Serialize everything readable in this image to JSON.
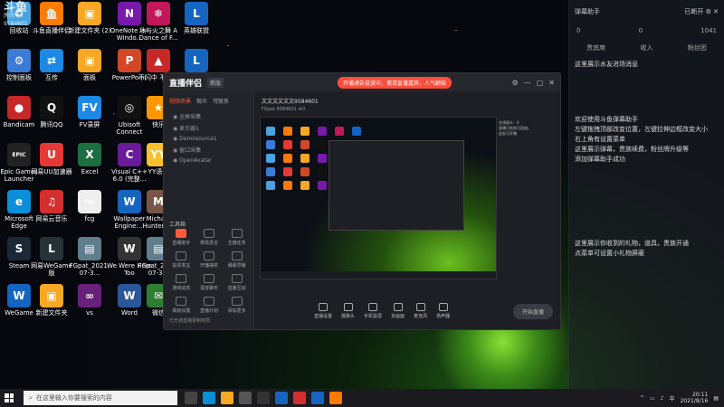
{
  "desktop": {
    "watermark_top": "斗鱼",
    "room_label": "房间号",
    "room_number": "9584601",
    "icons": [
      {
        "name": "recycle-bin-icon",
        "label": "回收站",
        "color": "#4aa3df",
        "glyph": "♻"
      },
      {
        "name": "control-panel-icon",
        "label": "控制面板",
        "color": "#3a7bd5",
        "glyph": "⚙"
      },
      {
        "name": "bandicam-icon",
        "label": "Bandicam",
        "color": "#c62828",
        "glyph": "●"
      },
      {
        "name": "epic-games-icon",
        "label": "Epic Games Launcher",
        "color": "#222",
        "glyph": "EPIC"
      },
      {
        "name": "microsoft-edge-icon",
        "label": "Microsoft Edge",
        "color": "#0a8fd8",
        "glyph": "e"
      },
      {
        "name": "steam-icon",
        "label": "Steam",
        "color": "#1b2838",
        "glyph": "S"
      },
      {
        "name": "wegame-icon",
        "label": "WeGame",
        "color": "#1565c0",
        "glyph": "W"
      },
      {
        "name": "douyu-app-icon",
        "label": "斗鱼直播伴侣",
        "color": "#ff7a00",
        "glyph": "鱼"
      },
      {
        "name": "interconnect-icon",
        "label": "互传",
        "color": "#1e88e5",
        "glyph": "⇄"
      },
      {
        "name": "tencent-qq-icon",
        "label": "腾讯QQ",
        "color": "#111",
        "glyph": "Q"
      },
      {
        "name": "netease-uu-icon",
        "label": "网易UU加速器",
        "color": "#e53935",
        "glyph": "U"
      },
      {
        "name": "netease-music-icon",
        "label": "网易云音乐",
        "color": "#d32f2f",
        "glyph": "♫"
      },
      {
        "name": "wegame-lol-icon",
        "label": "网易WeGame版",
        "color": "#263238",
        "glyph": "L"
      },
      {
        "name": "new-folder-icon",
        "label": "新建文件夹",
        "color": "#f9a825",
        "glyph": "▣"
      },
      {
        "name": "folder-2-icon",
        "label": "新建文件夹 (2)",
        "color": "#f9a825",
        "glyph": "▣"
      },
      {
        "name": "pdd-icon",
        "label": "面板",
        "color": "#f9a825",
        "glyph": "▣"
      },
      {
        "name": "fv-record-icon",
        "label": "FV录屏",
        "color": "#1e88e5",
        "glyph": "FV"
      },
      {
        "name": "excel-icon",
        "label": "Excel",
        "color": "#1d6f42",
        "glyph": "X"
      },
      {
        "name": "fcg-icon",
        "label": "fcg",
        "color": "#eee",
        "glyph": "fcg"
      },
      {
        "name": "fgpat-icon",
        "label": "FGpat_2021-07-3...",
        "color": "#607d8b",
        "glyph": "▤"
      },
      {
        "name": "vs-icon",
        "label": "vs",
        "color": "#68217a",
        "glyph": "∞"
      },
      {
        "name": "new-folder-2-icon",
        "label": "新建文件夹",
        "color": "#f9a825",
        "glyph": "▣"
      },
      {
        "name": "onenote-icon",
        "label": "OneNote for Windo...",
        "color": "#7719aa",
        "glyph": "N"
      },
      {
        "name": "powerpoint-icon",
        "label": "PowerPoint",
        "color": "#d24726",
        "glyph": "P"
      },
      {
        "name": "ubisoft-icon",
        "label": "Ubisoft Connect",
        "color": "#111",
        "glyph": "◎"
      },
      {
        "name": "visual-cpp-icon",
        "label": "Visual C++ 6.0 (完整...",
        "color": "#6a1b9a",
        "glyph": "C"
      },
      {
        "name": "wallpaper-engine-icon",
        "label": "Wallpaper Engine:...",
        "color": "#1565c0",
        "glyph": "W"
      },
      {
        "name": "we-were-here-icon",
        "label": "We Were Here Too",
        "color": "#333",
        "glyph": "W"
      },
      {
        "name": "word-icon",
        "label": "Word",
        "color": "#2b579a",
        "glyph": "W"
      },
      {
        "name": "michael-hunter-icon",
        "label": "Michael Hunter -...",
        "color": "#795548",
        "glyph": "M"
      },
      {
        "name": "fgpat-2-icon",
        "label": "FGpat_2021-07-3...",
        "color": "#607d8b",
        "glyph": "▤"
      },
      {
        "name": "dance-icon",
        "label": "冰与火之舞 A Dance of F...",
        "color": "#c2185b",
        "glyph": "❄"
      },
      {
        "name": "buzheng-icon",
        "label": "不闪中 不闪中",
        "color": "#c62828",
        "glyph": "▲"
      },
      {
        "name": "kuai-icon",
        "label": "快乐",
        "color": "#ff9800",
        "glyph": "★"
      },
      {
        "name": "yy-icon",
        "label": "YY语音",
        "color": "#fbc02d",
        "glyph": "YY"
      },
      {
        "name": "wechat-icon",
        "label": "微信",
        "color": "#2e7d32",
        "glyph": "✉"
      },
      {
        "name": "lol-icon",
        "label": "英雄联盟",
        "color": "#1565c0",
        "glyph": "L"
      },
      {
        "name": "lol-2-icon",
        "label": "英雄联盟",
        "color": "#1565c0",
        "glyph": "L"
      },
      {
        "name": "green-folder-icon",
        "label": "格式",
        "color": "#ff7043",
        "glyph": "▣"
      },
      {
        "name": "tool-icon",
        "label": "剪映",
        "color": "#111",
        "glyph": "✂"
      },
      {
        "name": "mobile-icon",
        "label": "酷狗",
        "color": "#1976d2",
        "glyph": "♪"
      },
      {
        "name": "extra-icon",
        "label": "穿越",
        "color": "#444",
        "glyph": "▣"
      },
      {
        "name": "extra2-icon",
        "label": "奇妙",
        "color": "#3949ab",
        "glyph": "▣"
      }
    ]
  },
  "side_panel": {
    "title": "弹幕助手",
    "status": "已断开",
    "stats": [
      "0",
      "0",
      "1041"
    ],
    "tabs": [
      "贵宾席",
      "收入",
      "粉丝团"
    ],
    "notice_line": "这里展示水友进场消息",
    "welcome_lines": [
      "欢迎使用斗鱼弹幕助手",
      "左键拖拽顶部改变位置，左键拉伸边框改变大小",
      "右上角有设置菜单",
      "这里展示弹幕，贵族续费，粉丝牌升级等",
      "添加弹幕助手成功"
    ],
    "gift_lines": [
      "这里展示你收到的礼物，道具，贵族开通",
      "点菜单可设置小礼物屏蔽"
    ]
  },
  "app": {
    "logo": "直播伴侣",
    "version": "新版",
    "notice": "开播通告投放中，邀请直播嘉宾，人气翻倍",
    "left_tabs": [
      "视频场景",
      "观众",
      "可联系"
    ],
    "scenes": [
      "全屏采集",
      "显示器1",
      "Demosource1",
      "窗口采集",
      "OpenAvatar"
    ],
    "tools_title": "工具箱",
    "tools": [
      "直播助手",
      "表情发言",
      "主播任务",
      "投票发言",
      "开播抽奖",
      "弹幕导播",
      "游戏动态",
      "语音聊天",
      "直播互动",
      "高级设置",
      "直播计划",
      "添加更多"
    ],
    "left_foot": "已开通直播录制权限",
    "room_title": "文文文文文文9584601",
    "room_meta": "FGpat  9584601  ★0",
    "side_hints": [
      "在线观众：0",
      "直播已结束可回放。\n此处可开播"
    ],
    "bottom": [
      "直播设置",
      "摄像头",
      "手机投屏",
      "多画面",
      "麦克风",
      "扬声器"
    ],
    "start_label": "开始直播"
  },
  "taskbar": {
    "search_placeholder": "在这里输入你要搜索的内容",
    "time": "20:11",
    "date": "2021/8/16",
    "lang": "中"
  }
}
